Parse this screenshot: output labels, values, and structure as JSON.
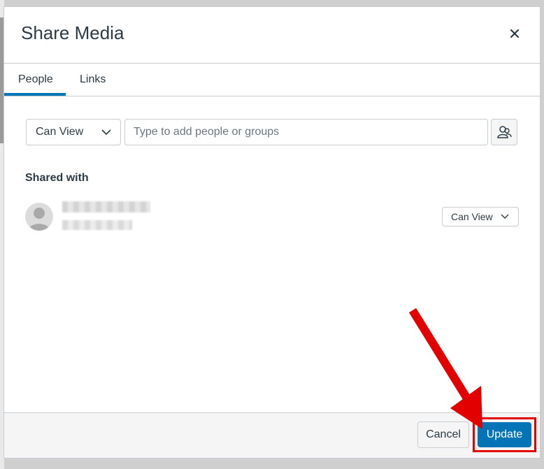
{
  "modal": {
    "title": "Share Media"
  },
  "tabs": [
    {
      "label": "People"
    },
    {
      "label": "Links"
    }
  ],
  "add_people": {
    "permission": "Can View",
    "placeholder": "Type to add people or groups"
  },
  "shared_with": {
    "heading": "Shared with",
    "entries": [
      {
        "permission": "Can View"
      }
    ]
  },
  "footer": {
    "cancel_label": "Cancel",
    "update_label": "Update"
  },
  "colors": {
    "accent": "#0374b5",
    "annotation": "#e30000",
    "text": "#2d3b45"
  },
  "icons": {
    "close": "close-icon",
    "select": "chevron-down-icon",
    "people": "people-browse-icon",
    "annotation": "red-arrow"
  }
}
